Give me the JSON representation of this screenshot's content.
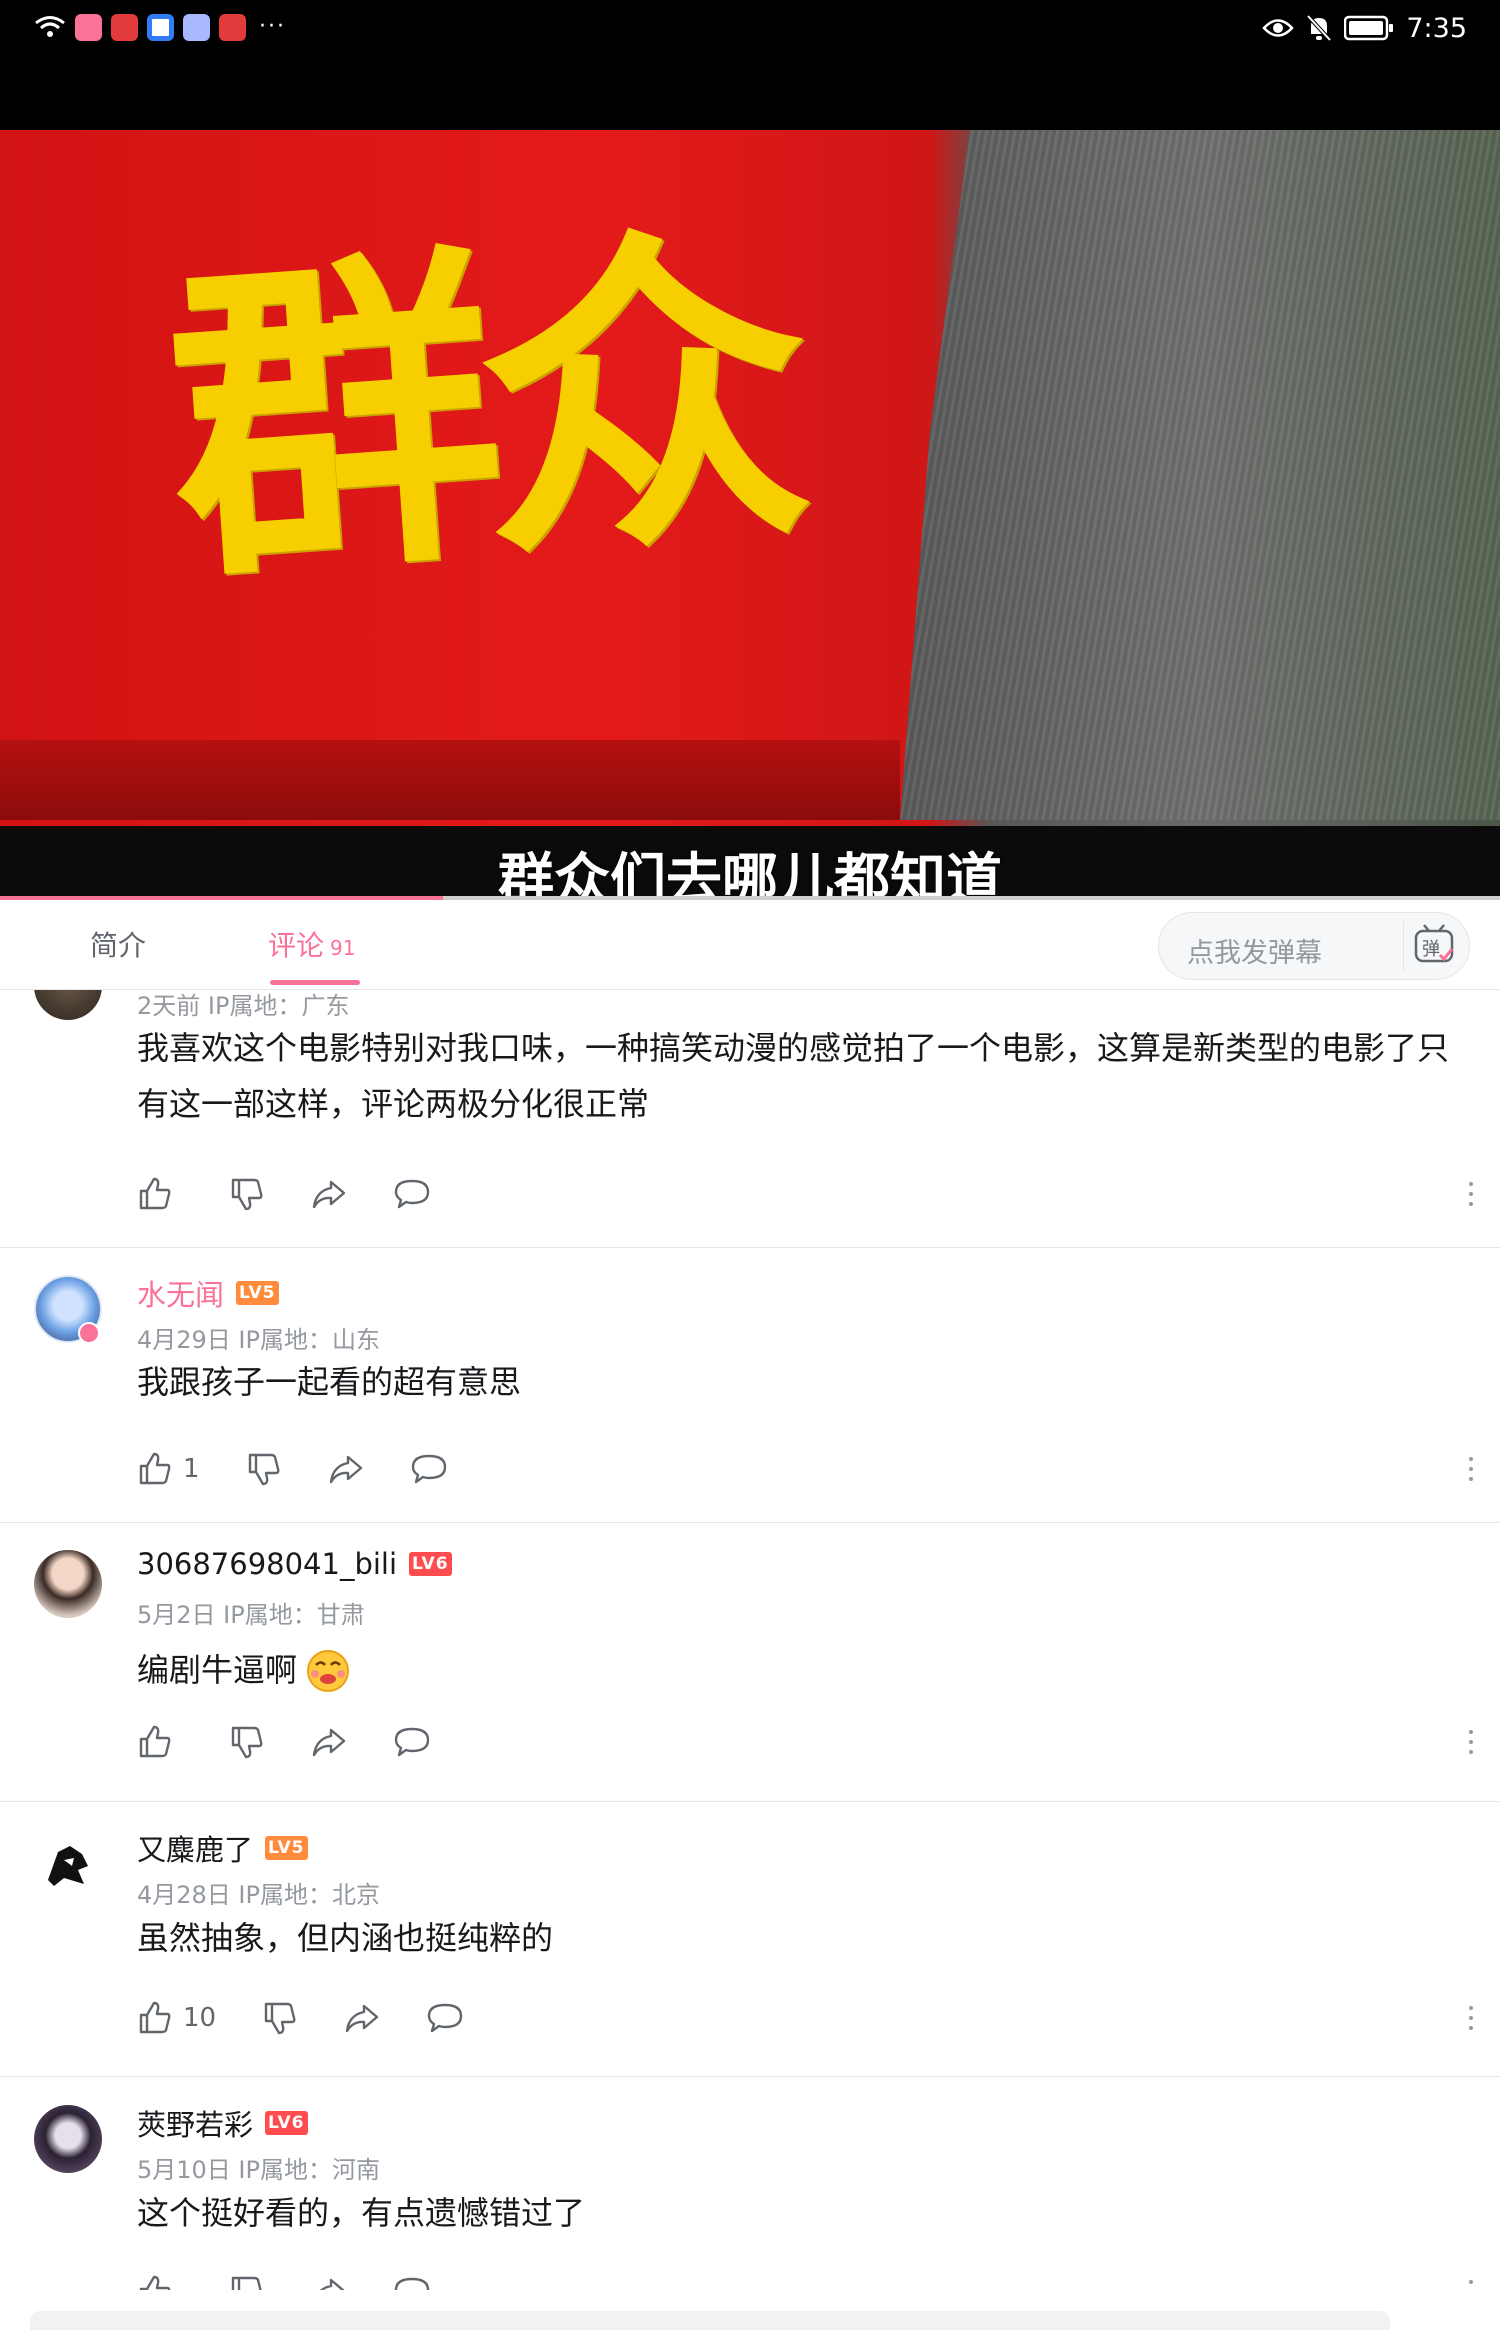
{
  "status_bar": {
    "time": "7:35",
    "app_icons": [
      "wifi-icon",
      "bilibili-app-icon",
      "huawei-app-icon",
      "security-app-icon",
      "music-app-icon",
      "huawei-app-icon"
    ],
    "more": "···"
  },
  "video": {
    "frame_text": "群众",
    "subtitle": "群众们去哪儿都知道",
    "progress": 0.295
  },
  "tabs": {
    "intro": "简介",
    "comments": "评论",
    "comments_count": "91"
  },
  "danmaku": {
    "placeholder": "点我发弹幕",
    "button_icon": "danmaku-icon",
    "button_char": "弹"
  },
  "comments": [
    {
      "username": "",
      "meta": "2天前  IP属地：广东",
      "content": "我喜欢这个电影特别对我口味，一种搞笑动漫的感觉拍了一个电影，这算是新类型的电影了只有这一部这样，评论两极分化很正常",
      "likes": ""
    },
    {
      "username": "水无闻",
      "level": "LV5",
      "meta": "4月29日  IP属地：山东",
      "content": "我跟孩子一起看的超有意思",
      "likes": "1"
    },
    {
      "username": "30687698041_bili",
      "level": "LV6",
      "meta": "5月2日  IP属地：甘肃",
      "content": "编剧牛逼啊",
      "likes": ""
    },
    {
      "username": "又麋鹿了",
      "level": "LV5",
      "meta": "4月28日  IP属地：北京",
      "content": "虽然抽象，但内涵也挺纯粹的",
      "likes": "10"
    },
    {
      "username": "莢野若彩",
      "level": "LV6",
      "meta": "5月10日  IP属地：河南",
      "content": "这个挺好看的，有点遗憾错过了",
      "likes": ""
    }
  ],
  "colors": {
    "accent_pink": "#fb7299",
    "level5": "#ff8c3d",
    "level6": "#ff4d4f",
    "text_secondary": "#9499a0"
  }
}
